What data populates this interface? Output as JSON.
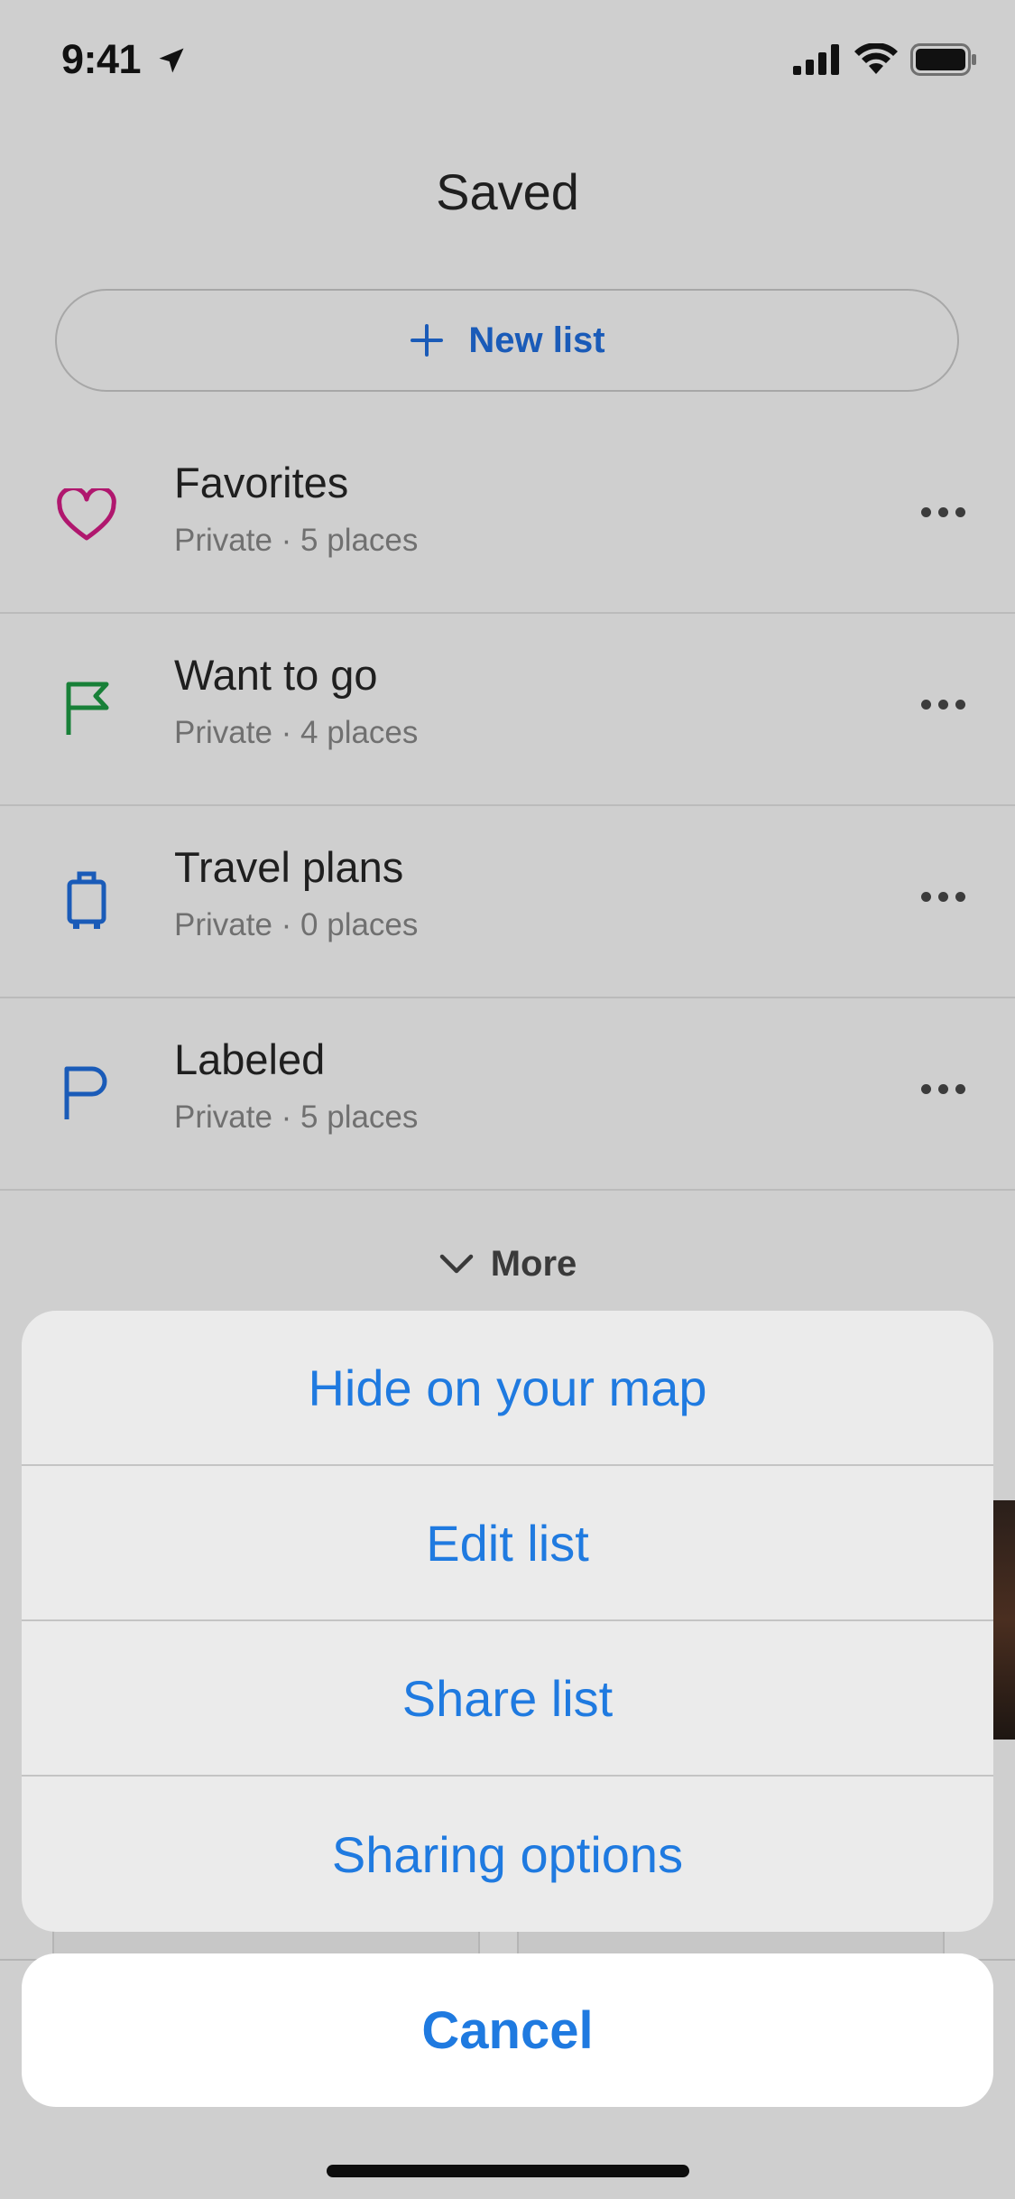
{
  "status_bar": {
    "time": "9:41"
  },
  "header": {
    "title": "Saved"
  },
  "new_list": {
    "label": "New list"
  },
  "lists": [
    {
      "name": "Favorites",
      "meta": "Private · 5 places",
      "icon": "heart-icon",
      "color": "#b0176e"
    },
    {
      "name": "Want to go",
      "meta": "Private · 4 places",
      "icon": "flag-icon",
      "color": "#188038"
    },
    {
      "name": "Travel plans",
      "meta": "Private · 0 places",
      "icon": "suitcase-icon",
      "color": "#1a5bb8"
    },
    {
      "name": "Labeled",
      "meta": "Private · 5 places",
      "icon": "label-flag-icon",
      "color": "#1a5bb8"
    }
  ],
  "more": {
    "label": "More"
  },
  "action_sheet": {
    "options": [
      "Hide on your map",
      "Edit list",
      "Share list",
      "Sharing options"
    ],
    "cancel": "Cancel"
  },
  "colors": {
    "accent": "#1f7ae0",
    "link_blue": "#1a5bb8"
  }
}
